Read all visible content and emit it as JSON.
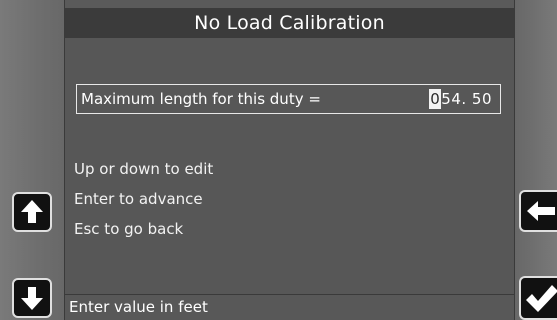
{
  "screen": {
    "title": "No Load Calibration"
  },
  "field": {
    "label": "Maximum length for this duty =",
    "value_cursor_digit": "0",
    "value_rest": "54. 50"
  },
  "instructions": [
    "Up or down to edit",
    "Enter to advance",
    "Esc to go back"
  ],
  "status": {
    "text": "Enter value in feet"
  },
  "buttons": {
    "up": "arrow-up-icon",
    "down": "arrow-down-icon",
    "back": "arrow-left-icon",
    "enter": "checkmark-icon"
  },
  "colors": {
    "screen_bg": "#575757",
    "title_bg": "#3b3b3b",
    "button_bg": "#111111"
  }
}
